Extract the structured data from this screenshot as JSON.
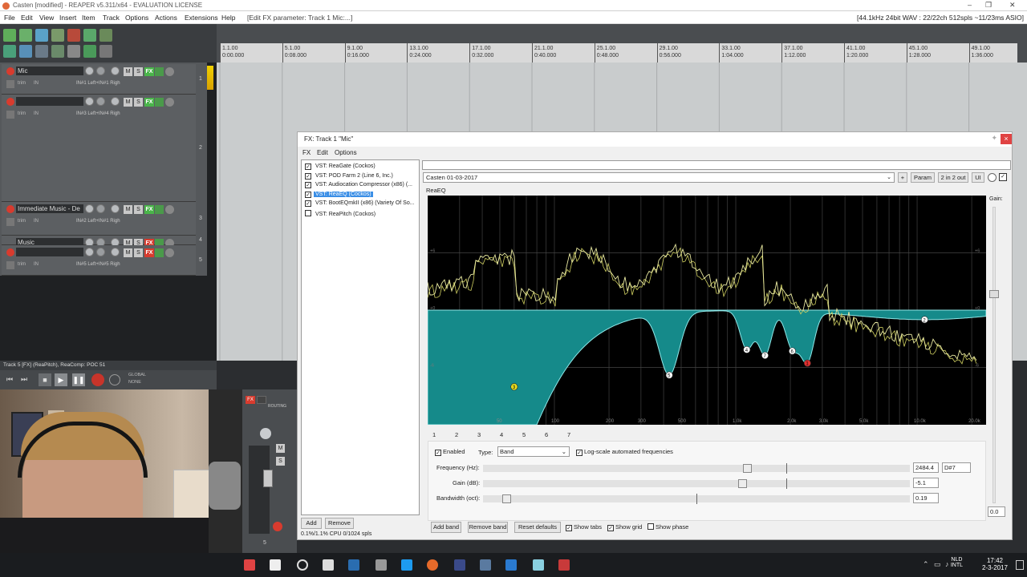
{
  "window": {
    "title": "Casten [modified] - REAPER v5.311/x64 - EVALUATION LICENSE",
    "audio_info": "[44.1kHz 24bit WAV : 22/22ch 512spls ~11/23ms ASIO]"
  },
  "menu": {
    "items": [
      "File",
      "Edit",
      "View",
      "Insert",
      "Item",
      "Track",
      "Options",
      "Actions",
      "Extensions",
      "Help"
    ],
    "context": "[Edit FX parameter: Track 1 Mic:...]"
  },
  "ruler": {
    "ticks": [
      {
        "bar": "1.1.00",
        "time": "0:00.000"
      },
      {
        "bar": "5.1.00",
        "time": "0:08.000"
      },
      {
        "bar": "9.1.00",
        "time": "0:16.000"
      },
      {
        "bar": "13.1.00",
        "time": "0:24.000"
      },
      {
        "bar": "17.1.00",
        "time": "0:32.000"
      },
      {
        "bar": "21.1.00",
        "time": "0:40.000"
      },
      {
        "bar": "25.1.00",
        "time": "0:48.000"
      },
      {
        "bar": "29.1.00",
        "time": "0:56.000"
      },
      {
        "bar": "33.1.00",
        "time": "1:04.000"
      },
      {
        "bar": "37.1.00",
        "time": "1:12.000"
      },
      {
        "bar": "41.1.00",
        "time": "1:20.000"
      },
      {
        "bar": "45.1.00",
        "time": "1:28.000"
      },
      {
        "bar": "49.1.00",
        "time": "1:36.000"
      }
    ]
  },
  "tracks": [
    {
      "num": "1",
      "name": "Mic",
      "route": "IN#1 Left+IN#1 Righ",
      "fx_on": true
    },
    {
      "num": "2",
      "name": "",
      "route": "IN#3 Left+IN#4 Righ",
      "fx_on": true
    },
    {
      "num": "3",
      "name": "Immediate Music - De",
      "route": "IN#2 Left+IN#1 Righ",
      "fx_on": true
    },
    {
      "num": "4",
      "name": "Music",
      "route": "",
      "fx_on": false
    },
    {
      "num": "5",
      "name": "",
      "route": "IN#5 Left+IN#5 Righ",
      "fx_on": false
    }
  ],
  "track_buttons": {
    "mute": "M",
    "solo": "S",
    "fx": "FX",
    "trim": "trim",
    "in": "IN"
  },
  "status_strip": "Track 5 [FX] (ReaPitch), ReaComp: POC 51",
  "transport": {
    "global": "GLOBAL",
    "none": "NONE"
  },
  "mixer": {
    "fx": "FX",
    "routing": "ROUTING",
    "mute": "M",
    "solo": "S",
    "number": "5"
  },
  "fx_window": {
    "title": "FX: Track 1 \"Mic\"",
    "close": "×",
    "menu": [
      "FX",
      "Edit",
      "Options"
    ],
    "plugins": [
      {
        "checked": true,
        "name": "VST: ReaGate (Cockos)",
        "selected": false
      },
      {
        "checked": true,
        "name": "VST: POD Farm 2 (Line 6, Inc.)",
        "selected": false
      },
      {
        "checked": true,
        "name": "VST: Audiocation Compressor (x86) (...",
        "selected": false
      },
      {
        "checked": true,
        "name": "VST: ReaEQ (Cockos)",
        "selected": true
      },
      {
        "checked": true,
        "name": "VST: BootEQmkII (x86) (Variety Of So...",
        "selected": false
      },
      {
        "checked": false,
        "name": "VST: ReaPitch (Cockos)",
        "selected": false
      }
    ],
    "add": "Add",
    "remove": "Remove",
    "cpu": "0.1%/1.1% CPU 0/1024 spls",
    "preset": "Casten 01-03-2017",
    "plus": "+",
    "param": "Param",
    "io": "2 in 2 out",
    "ui": "UI",
    "plugin_label": "ReaEQ",
    "gain_label": "Gain:",
    "gain_value": "0.0"
  },
  "eq": {
    "freq_labels": [
      "50",
      "100",
      "200",
      "300",
      "500",
      "1.0k",
      "2.0k",
      "3.0k",
      "5.0k",
      "10.0k",
      "20.0k"
    ],
    "db_left": [
      "+6",
      "+0",
      "-6"
    ],
    "db_right": [
      "+6",
      "+0",
      "-6"
    ],
    "bands": [
      {
        "id": "2",
        "freq": 11000,
        "gain": -1.0
      },
      {
        "id": "3",
        "freq": 60,
        "gain": -7.2
      },
      {
        "id": "4",
        "freq": 1150,
        "gain": -4.0
      },
      {
        "id": "5",
        "freq": 430,
        "gain": -6.5
      },
      {
        "id": "6",
        "freq": 2050,
        "gain": -3.8
      },
      {
        "id": "7",
        "freq": 1450,
        "gain": -4.6
      },
      {
        "id": "1",
        "freq": 2484.4,
        "gain": -5.1
      }
    ],
    "tabs": [
      "1",
      "2",
      "3",
      "4",
      "5",
      "6",
      "7"
    ]
  },
  "params": {
    "enabled_label": "Enabled",
    "type_label": "Type:",
    "type_value": "Band",
    "logscale_label": "Log-scale automated frequencies",
    "freq_label": "Frequency (Hz):",
    "freq_value": "2484.4",
    "note_value": "D#7",
    "gain_label": "Gain (dB):",
    "gain_value": "-5.1",
    "bw_label": "Bandwidth (oct):",
    "bw_value": "0.19"
  },
  "bottom_buttons": {
    "add_band": "Add band",
    "remove_band": "Remove band",
    "reset": "Reset defaults",
    "show_tabs": "Show tabs",
    "show_grid": "Show grid",
    "show_phase": "Show phase"
  },
  "taskbar": {
    "lang_top": "NLD",
    "lang_bottom": "INTL",
    "time": "17:42",
    "date": "2-3-2017"
  }
}
